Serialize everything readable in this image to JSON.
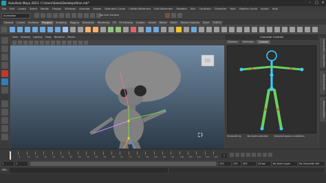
{
  "window": {
    "title": "Autodesk Maya 2023: C:\\Users\\Sekai\\Desktop\\Alien.mb*"
  },
  "menubar": {
    "items": [
      "File",
      "Edit",
      "Create",
      "Select",
      "Modify",
      "Display",
      "Windows",
      "Animate",
      "Assets",
      "Geometry Cache",
      "Create Deformers",
      "Edit Deformers",
      "Skeleton",
      "Skin",
      "Constrain",
      "Character",
      "Help",
      "Pipeline Cache",
      "Arnold",
      "Help"
    ]
  },
  "statusline": {
    "mode": "Animation",
    "live_surface": "No Live Surface"
  },
  "shelf": {
    "tabs": [
      "General",
      "Curves",
      "Surfaces",
      "Polygons",
      "Sculpting",
      "Rigging",
      "Animation",
      "Rendering",
      "FX",
      "FX Caching",
      "Custom",
      "Arnold",
      "Bifrost",
      "MASH",
      "Motion Graphics",
      "XGen",
      "TURTLE"
    ],
    "active_tab": "Polygons"
  },
  "viewport": {
    "menu": [
      "View",
      "Shading",
      "Lighting",
      "Show",
      "Renderer",
      "Panels"
    ],
    "sky_top": "#6f8aa4",
    "sky_bottom": "#2c3a47",
    "alien_skin": "#8a8a8a"
  },
  "side_panel": {
    "header": "Character Controls",
    "tabs": [
      "Skeleton",
      "Definition",
      "Controls"
    ],
    "active_tab": "Controls",
    "source_label": "HumanIK rig",
    "selection_label": "No mode selected",
    "status": "Selected bones in skeleton",
    "controls_color": "#3bd1ff",
    "limb_color": "#6ad35b"
  },
  "right_tabs": [
    "Channel Box / Layer Editor",
    "Attribute Editor",
    "Modeling Toolkit"
  ],
  "timeslider": {
    "ticks": [
      "1",
      "5",
      "10",
      "15",
      "20",
      "25",
      "30",
      "35",
      "40",
      "45",
      "50",
      "55",
      "60",
      "65",
      "70",
      "75",
      "80",
      "85",
      "90",
      "95",
      "100",
      "105",
      "110",
      "115",
      "120"
    ],
    "current_frame": "1"
  },
  "rangeslider": {
    "start": "1",
    "start_inner": "1",
    "end_inner": "120",
    "end": "120",
    "end_outer": "200",
    "fps": "24 fps",
    "anim_layer": "No Anim Layer",
    "char_set": "No Character Set"
  },
  "commandline": {
    "label": "MEL"
  }
}
